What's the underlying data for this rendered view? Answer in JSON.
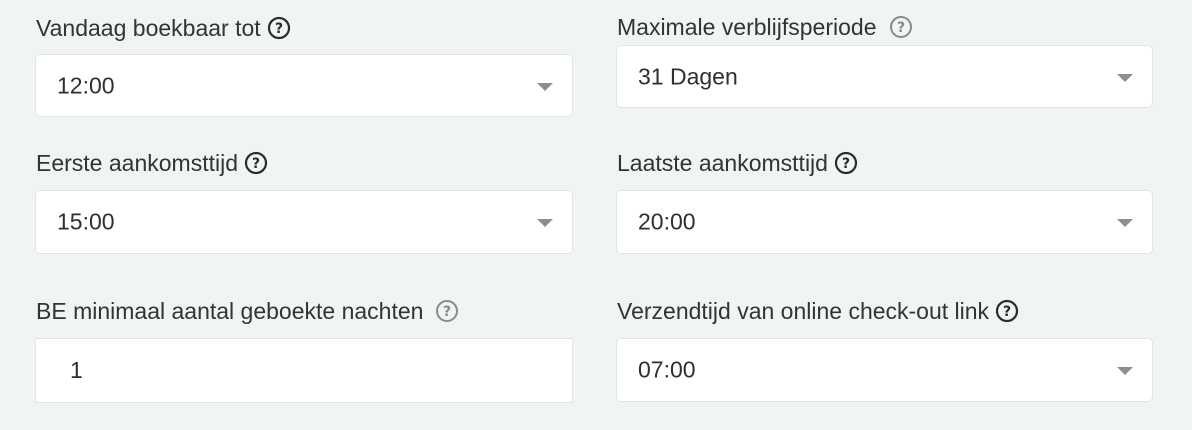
{
  "fields": {
    "vandaag_boekbaar": {
      "label": "Vandaag boekbaar tot",
      "value": "12:00",
      "help_icon": "question-circle-icon"
    },
    "maximale_verblijfsperiode": {
      "label": "Maximale verblijfsperiode",
      "value": "31 Dagen",
      "help_icon": "question-circle-icon"
    },
    "eerste_aankomsttijd": {
      "label": "Eerste aankomsttijd",
      "value": "15:00",
      "help_icon": "question-circle-icon"
    },
    "laatste_aankomsttijd": {
      "label": "Laatste aankomsttijd",
      "value": "20:00",
      "help_icon": "question-circle-icon"
    },
    "be_minimaal_nachten": {
      "label": "BE minimaal aantal geboekte nachten",
      "value": "1",
      "help_icon": "question-circle-icon"
    },
    "verzendtijd_checkout": {
      "label": "Verzendtijd van online check-out link",
      "value": "07:00",
      "help_icon": "question-circle-icon"
    }
  },
  "colors": {
    "background": "#f0f4f3",
    "field_background": "#ffffff",
    "field_border": "#e1e5e4",
    "text": "#2f2f2f",
    "caret": "#8e8e8e",
    "help_dark": "#2b2b2b",
    "help_light": "#8a8a8a"
  }
}
